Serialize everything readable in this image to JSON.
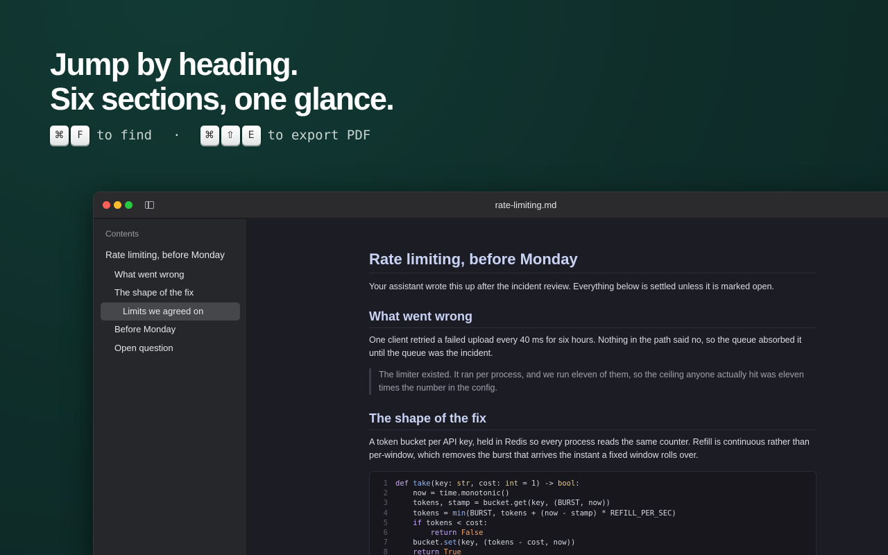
{
  "hero": {
    "headline_line1": "Jump by heading.",
    "headline_line2": "Six sections, one glance.",
    "find_keys": [
      "⌘",
      "F"
    ],
    "find_text": "to find",
    "separator": "·",
    "export_keys": [
      "⌘",
      "⇧",
      "E"
    ],
    "export_text": "to export PDF"
  },
  "window": {
    "title": "rate-limiting.md"
  },
  "sidebar": {
    "label": "Contents",
    "items": [
      {
        "label": "Rate limiting, before Monday",
        "level": 1,
        "active": false
      },
      {
        "label": "What went wrong",
        "level": 2,
        "active": false
      },
      {
        "label": "The shape of the fix",
        "level": 2,
        "active": false
      },
      {
        "label": "Limits we agreed on",
        "level": 3,
        "active": true
      },
      {
        "label": "Before Monday",
        "level": 2,
        "active": false
      },
      {
        "label": "Open question",
        "level": 2,
        "active": false
      }
    ]
  },
  "document": {
    "h1": "Rate limiting, before Monday",
    "intro": "Your assistant wrote this up after the incident review. Everything below is settled unless it is marked open.",
    "section1_heading": "What went wrong",
    "section1_body": "One client retried a failed upload every 40 ms for six hours. Nothing in the path said no, so the queue absorbed it until the queue was the incident.",
    "section1_quote": "The limiter existed. It ran per process, and we run eleven of them, so the ceiling anyone actually hit was eleven times the number in the config.",
    "section2_heading": "The shape of the fix",
    "section2_body": "A token bucket per API key, held in Redis so every process reads the same counter. Refill is continuous rather than per-window, which removes the burst that arrives the instant a fixed window rolls over.",
    "code_lines": [
      "def take(key: str, cost: int = 1) -> bool:",
      "    now = time.monotonic()",
      "    tokens, stamp = bucket.get(key, (BURST, now))",
      "    tokens = min(BURST, tokens + (now - stamp) * REFILL_PER_SEC)",
      "    if tokens < cost:",
      "        return False",
      "    bucket.set(key, (tokens - cost, now))",
      "    return True"
    ]
  }
}
